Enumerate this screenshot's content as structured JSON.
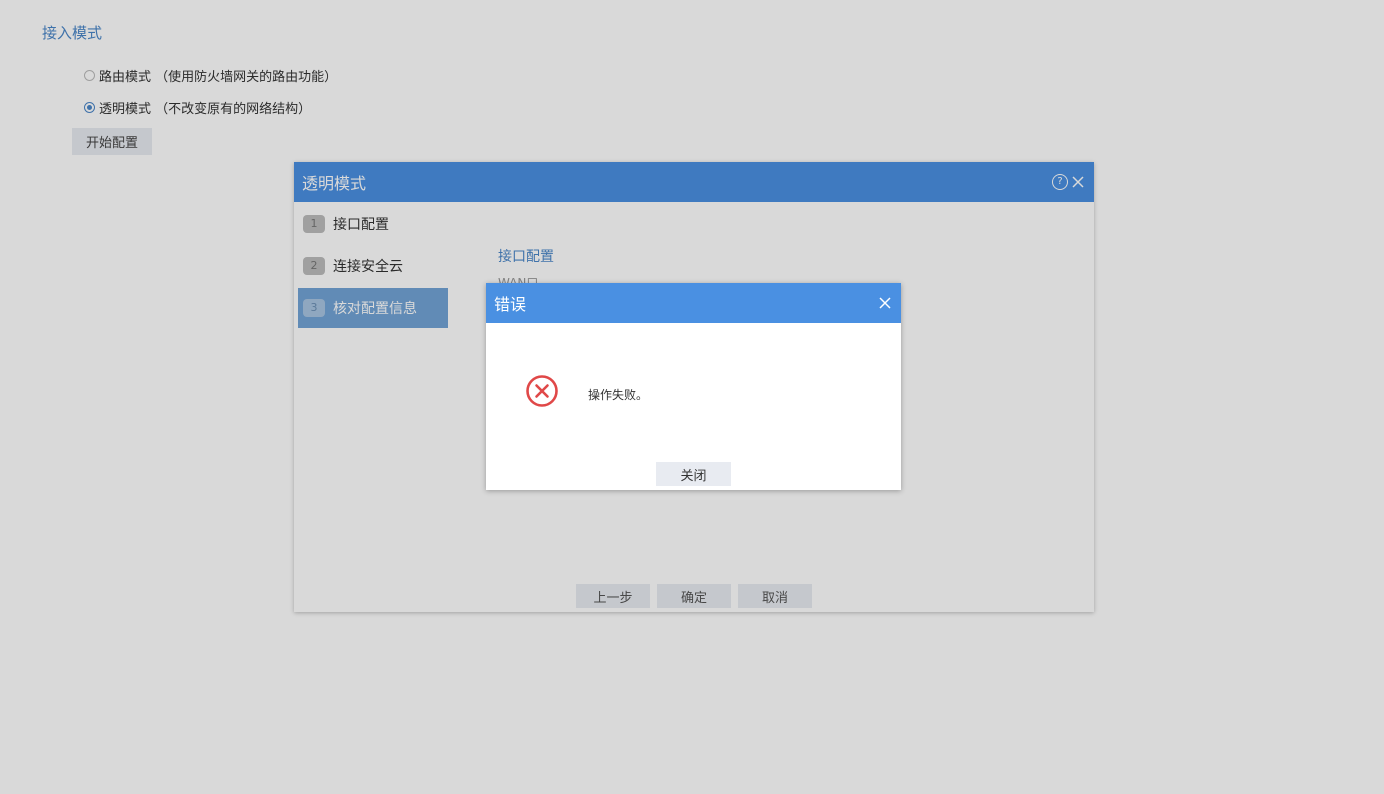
{
  "page": {
    "section_title": "接入模式",
    "radios": [
      {
        "label": "路由模式 （使用防火墙网关的路由功能）",
        "checked": false
      },
      {
        "label": "透明模式 （不改变原有的网络结构）",
        "checked": true
      }
    ],
    "start_button": "开始配置"
  },
  "wizard": {
    "title": "透明模式",
    "help_icon": "?",
    "steps": [
      {
        "num": "1",
        "label": "接口配置"
      },
      {
        "num": "2",
        "label": "连接安全云"
      },
      {
        "num": "3",
        "label": "核对配置信息"
      }
    ],
    "active_step": 3,
    "content_title": "接口配置",
    "content_sub": "WAN口",
    "buttons": {
      "prev": "上一步",
      "ok": "确定",
      "cancel": "取消"
    }
  },
  "error_dialog": {
    "title": "错误",
    "message": "操作失败。",
    "close_button": "关闭",
    "icon": "error-circle-x-icon"
  },
  "colors": {
    "header_blue": "#4a90e2",
    "accent_blue": "#4a86c8",
    "error_red": "#e04848",
    "button_bg": "#e8ebf1"
  }
}
